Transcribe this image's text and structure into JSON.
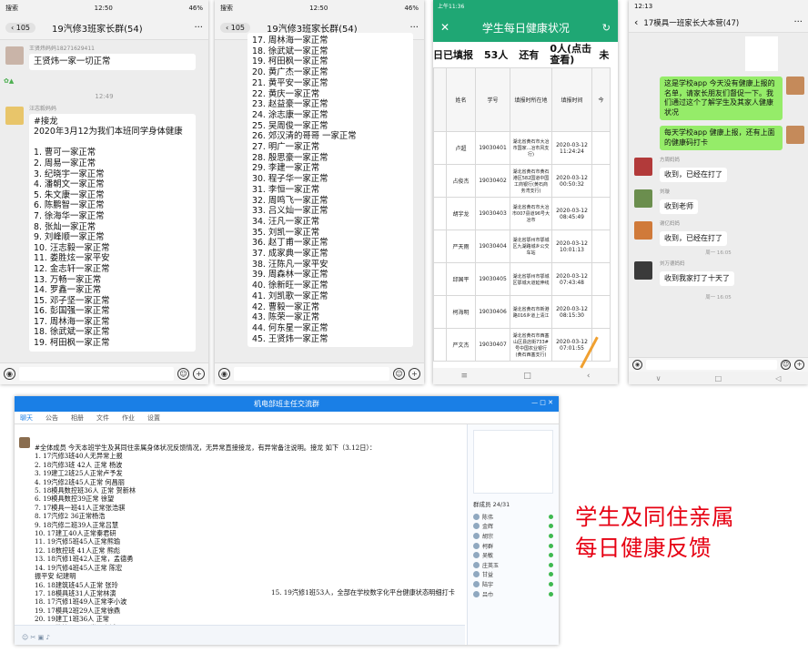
{
  "caption": {
    "line1": "学生及同住亲属",
    "line2": "每日健康反馈"
  },
  "shot1": {
    "status_left": "搜索",
    "status_time": "12:50",
    "status_right": "46%",
    "back_count": "105",
    "title": "19汽修3班家长群(54)",
    "sender1": "王贤炜妈妈18271629411",
    "msg1": "王贤炜一家一切正常",
    "time_mark": "12:49",
    "sender2": "汪志毅妈妈",
    "msg2": "#接龙\n2020年3月12为我们本班同学身体健康\n\n1. 曹可一家正常\n2. 周易一家正常\n3. 纪晓宇一家正常\n4. 潘朝文一家正常\n5. 朱文康一家正常\n6. 陈鹏智一家正常\n7. 徐海华一家正常\n8. 张灿一家正常\n9. 刘峰顺一家正常\n10. 汪志毅一家正常\n11. 娄胜炫一家平安\n12. 金志轩一家正常\n13. 万畅一家正常\n14. 罗鑫一家正常\n15. 邓子坚一家正常\n16. 彭国强一家正常\n17. 周林海一家正常\n18. 徐武斌一家正常\n19. 柯田枫一家正常"
  },
  "shot2": {
    "status_left": "搜索",
    "status_time": "12:50",
    "status_right": "46%",
    "back_count": "105",
    "title": "19汽修3班家长群(54)",
    "msg": "17. 周林海一家正常\n18. 徐武斌一家正常\n19. 柯田枫一家正常\n20. 黄广杰一家正常\n21. 黄平安一家正常\n22. 黄庆一家正常\n23. 赵益豪一家正常\n24. 涂志康一家正常\n25. 吴周俊一家正常\n26. 郊汉清的哥哥 一家正常\n27. 明广一家正常\n28. 殷思豪一家正常\n29. 李建一家正常\n30. 程子华一家正常\n31. 李恒一家正常\n32. 周鸣飞一家正常\n33. 吕义灿一家正常\n34. 汪凡一家正常\n35. 刘凯一家正常\n36. 赵丁甫一家正常\n37. 成家典一家正常\n38. 汪陈凡一家平安\n39. 周森林一家正常\n40. 徐新旺一家正常\n41. 刘凯歌一家正常\n42. 曹毅一家正常\n43. 陈荣一家正常\n44. 何东星一家正常\n45. 王贤炜一家正常"
  },
  "shot3": {
    "status_left": "上午11:36",
    "title": "学生每日健康状况",
    "summary": [
      "日已填报",
      "53人",
      "还有",
      "0人(点击查看)",
      "未"
    ],
    "headers": [
      "",
      "姓名",
      "学号",
      "填报时所在地",
      "填报时间",
      "今"
    ],
    "rows": [
      {
        "name": "卢超",
        "id": "19030401",
        "place": "湖北省黄石市大冶市国家...冶市风支行)",
        "time": "2020-03-12 11:24:24"
      },
      {
        "name": "占俊杰",
        "id": "19030402",
        "place": "湖北省黄石市黄石港区582国道中国工商银行(黄石商务湾支行)",
        "time": "2020-03-12 00:50:32"
      },
      {
        "name": "胡宇龙",
        "id": "19030403",
        "place": "湖北省黄石市大冶市007县道96号大冶市",
        "time": "2020-03-12 08:45:49"
      },
      {
        "name": "严天雨",
        "id": "19030404",
        "place": "湖北省鄂州市鄂城区九湖路城乡公交车站",
        "time": "2020-03-12 10:01:13"
      },
      {
        "name": "邱国平",
        "id": "19030405",
        "place": "湖北省鄂州市鄂城区鄂城大道延伸线",
        "time": "2020-03-12 07:43:48"
      },
      {
        "name": "柯海明",
        "id": "19030406",
        "place": "湖北省黄石市新港路016乡道上清江",
        "time": "2020-03-12 08:15:30"
      },
      {
        "name": "严文杰",
        "id": "19030407",
        "place": "湖北省黄石市西塞山区县店街733#号中国农业银行(黄石西塞支行)",
        "time": "2020-03-12 07:01:55"
      }
    ]
  },
  "shot4": {
    "status_left": "12:13",
    "title": "17模具一班家长大本营(47)",
    "msg_green1": "这是学校app 今天没有健康上报的名单，请家长朋友们督促一下。我们通过这个了解学生及其家人健康状况",
    "msg_green2": "每天学校app 健康上报，还有上面的健康码打卡",
    "sender_a": "方周妈妈",
    "msg_a": "收到，已经在打了",
    "sender_b": "刘璇",
    "msg_b": "收到老师",
    "sender_c": "谢亿妈妈",
    "msg_c": "收到，已经在打了",
    "time_mark1": "周一 16:05",
    "sender_d": "刘万德妈妈",
    "msg_d": "收到我家打了十天了",
    "time_mark2": "周一 16:05"
  },
  "shot5": {
    "window_title": "机电部班主任交流群",
    "tabs": [
      "聊天",
      "公告",
      "相册",
      "文件",
      "作业",
      "设置"
    ],
    "lines": [
      "#全体成员 今天本班学生及其同住亲属身体状况反馈情况，无异常直接接龙，有异常备注说明。接龙 如下（3.12日）：",
      "1. 17汽修3班40人无异常上报",
      "2. 18汽修3班    42人  正常   杨波",
      "3. 19建工2班25人正常卢予发",
      "4. 19汽修2班45人正常  何昌丽",
      "5.  18模具数控班36人 正常 贺新林",
      "6. 19模具数控39正常   徐望",
      "7. 17模具一班41人正常张浩骐",
      "8. 17汽修2   36正常杨浩",
      "9. 18汽修二班39人正常吕慧",
      "10. 17建工40人正常秦君研",
      "11. 19汽修5班45人正常熊瑜",
      "12. 18数控班  41人正常  熊彪",
      "13. 18汽修1班42人正常，孟德勇",
      "14. 19汽修4班45人正常  陈宏",
      "振平安        纪建明",
      "16. 18建筑班45人正常  张玲",
      "17. 18模具班31人正常林演",
      "18. 17汽修1班49人正常李小波",
      "19. 17模具2班29人正常徐鼎",
      "20. 19建工1班36人  正常",
      "21. 17数控29人正常夏亮斌"
    ],
    "side_line": "15. 19汽修1班53人，全部在学校数字化平台健康状态明细打卡",
    "members_header": "群成员 24/31",
    "members": [
      "陈伟",
      "金辉",
      "胡宗",
      "柯群",
      "吴敏",
      "庄英玉",
      "甘益",
      "陆宇",
      "吕巾"
    ]
  }
}
